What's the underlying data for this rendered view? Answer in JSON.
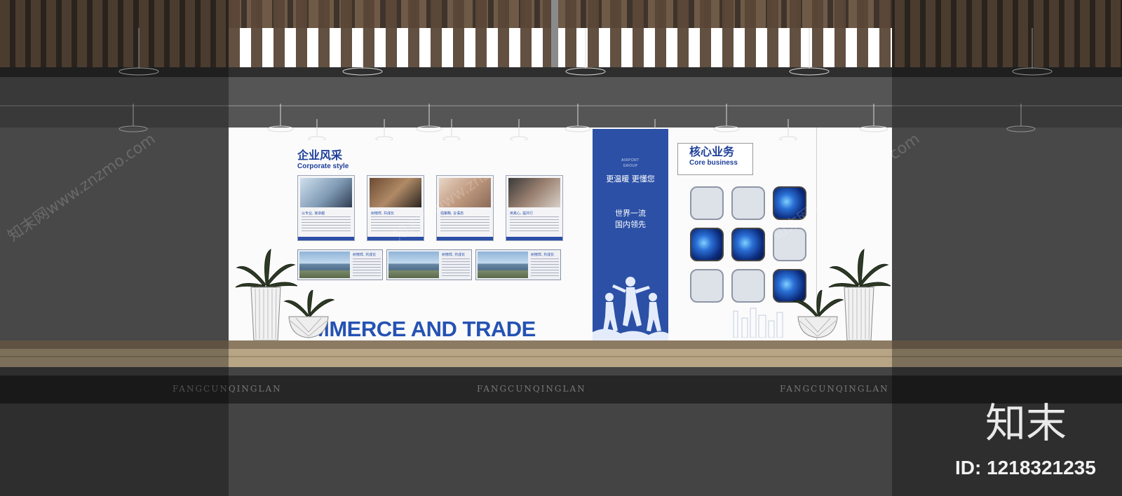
{
  "corporate_style": {
    "title_cn": "企业风采",
    "title_en": "Corporate style",
    "cards": [
      {
        "caption": "以专业, 谋卓越"
      },
      {
        "caption": "树榜样, 共成长"
      },
      {
        "caption": "强策略, 言语态"
      },
      {
        "caption": "用真心, 提共行"
      }
    ],
    "panels": [
      {
        "caption": "树榜样, 共成长"
      },
      {
        "caption": "树榜样, 共成长"
      },
      {
        "caption": "树榜样, 共成长"
      }
    ],
    "slogan": "MMERCE AND TRADE"
  },
  "banner": {
    "brand_line1": "AIRPORT",
    "brand_line2": "GROUP",
    "line1": "更温暖 更懂您",
    "line2": "世界一流",
    "line3": "国内领先"
  },
  "core_business": {
    "title_cn": "核心业务",
    "title_en": "Core business",
    "tiles": [
      "plain",
      "plain",
      "image",
      "image",
      "image",
      "plain",
      "plain",
      "plain",
      "image"
    ]
  },
  "floor_labels": [
    "FANGCUNQINGLAN",
    "FANGCUNQINGLAN",
    "FANGCUNQINGLAN"
  ],
  "watermark": {
    "brand": "知末",
    "id_text": "ID: 1218321235",
    "diagonal_text": "知末网www.znzmo.com"
  },
  "colors": {
    "brand_blue": "#2c50a6",
    "wall": "#fbfbfb",
    "wood": "#b8a585"
  }
}
